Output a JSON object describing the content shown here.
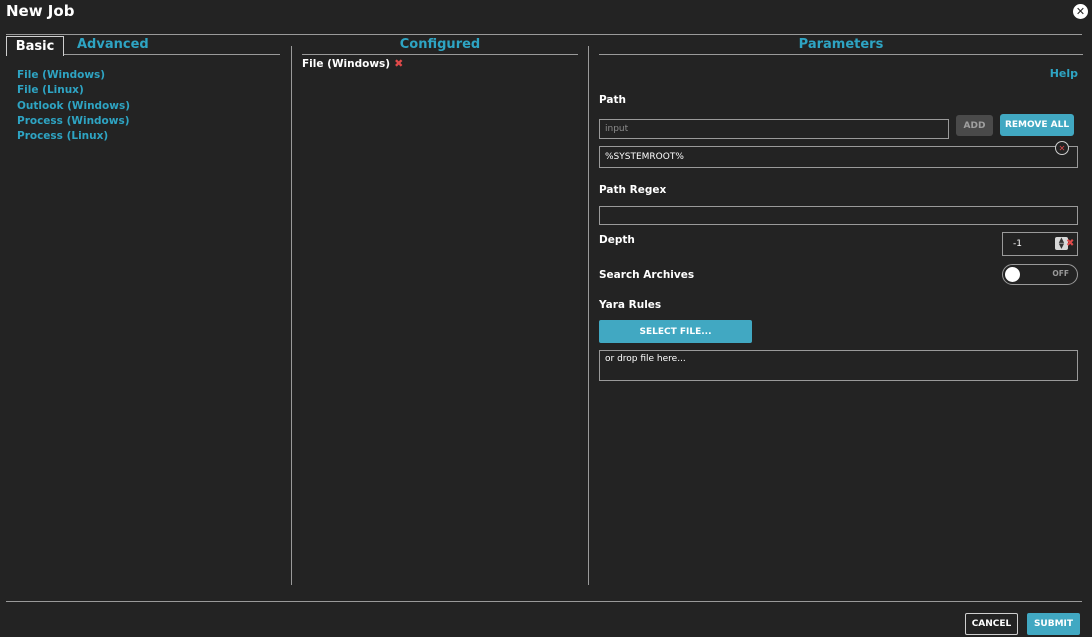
{
  "dialog": {
    "title": "New Job",
    "close_icon": "close-circle-icon"
  },
  "tabs": [
    {
      "label": "Basic",
      "active": true
    },
    {
      "label": "Advanced",
      "active": false
    }
  ],
  "job_types": [
    "File (Windows)",
    "File (Linux)",
    "Outlook (Windows)",
    "Process (Windows)",
    "Process (Linux)"
  ],
  "configured": {
    "header": "Configured",
    "items": [
      {
        "label": "File (Windows)",
        "remove_icon": "remove-x-icon"
      }
    ]
  },
  "parameters": {
    "header": "Parameters",
    "help_label": "Help",
    "path": {
      "label": "Path",
      "placeholder": "input",
      "add_label": "ADD",
      "remove_all_label": "REMOVE ALL",
      "values": [
        "%SYSTEMROOT%"
      ]
    },
    "path_regex": {
      "label": "Path Regex",
      "value": ""
    },
    "depth": {
      "label": "Depth",
      "value": "-1"
    },
    "search_archives": {
      "label": "Search Archives",
      "state": "OFF"
    },
    "yara_rules": {
      "label": "Yara Rules",
      "select_label": "SELECT FILE...",
      "drop_text": "or drop file here..."
    }
  },
  "footer": {
    "cancel_label": "CANCEL",
    "submit_label": "SUBMIT"
  },
  "colors": {
    "background": "#232323",
    "accent": "#41a8c2",
    "link": "#2ea4c3",
    "danger": "#e04a4a"
  }
}
